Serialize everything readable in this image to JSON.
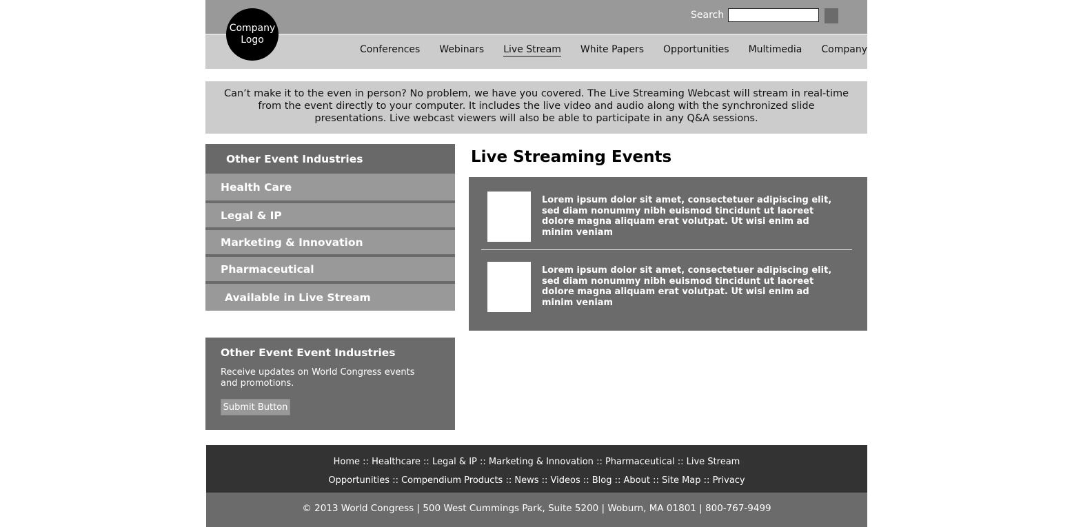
{
  "header": {
    "logo_text": "Company\nLogo",
    "search_label": "Search",
    "search_value": "",
    "nav": [
      {
        "label": "Conferences"
      },
      {
        "label": "Webinars"
      },
      {
        "label": "Live Stream"
      },
      {
        "label": "White Papers"
      },
      {
        "label": "Opportunities"
      },
      {
        "label": "Multimedia"
      },
      {
        "label": "Company"
      }
    ],
    "active_nav": "Live Stream"
  },
  "intro": {
    "text": "Can’t make it to the even in person? No problem, we have you covered. The Live Streaming Webcast will stream in real-time from the event directly to your computer. It includes the live video and audio along with the synchronized slide presentations. Live webcast viewers will also be able to participate in any Q&A sessions."
  },
  "sidebar": {
    "header": "Other Event Industries",
    "items": [
      {
        "label": "Health Care"
      },
      {
        "label": "Legal & IP"
      },
      {
        "label": "Marketing & Innovation"
      },
      {
        "label": "Pharmaceutical"
      },
      {
        "label": "Available in Live Stream"
      }
    ],
    "updates": {
      "title": "Other Event Event Industries",
      "text": "Receive updates on World Congress events and promotions.",
      "button": "Submit Button"
    }
  },
  "main": {
    "title": "Live Streaming Events",
    "events": [
      {
        "text": "Lorem ipsum dolor sit amet, consectetuer adipiscing elit, sed diam nonummy nibh euismod tincidunt ut laoreet dolore magna aliquam erat volutpat. Ut wisi enim ad minim veniam"
      },
      {
        "text": "Lorem ipsum dolor sit amet, consectetuer adipiscing elit, sed diam nonummy nibh euismod tincidunt ut laoreet dolore magna aliquam erat volutpat. Ut wisi enim ad minim veniam"
      }
    ]
  },
  "footer": {
    "row1": [
      "Home",
      "Healthcare",
      "Legal & IP",
      "Marketing & Innovation",
      "Pharmaceutical",
      "Live Stream"
    ],
    "row2": [
      "Opportunities",
      "Compendium Products",
      "News",
      "Videos",
      "Blog",
      "About",
      "Site Map",
      "Privacy"
    ],
    "separator": " :: ",
    "copyright": "© 2013 World Congress | 500 West Cummings Park, Suite 5200 | Woburn, MA 01801 | 800-767-9499"
  },
  "colors": {
    "header_top": "#999999",
    "header_nav": "#cccccc",
    "panel_dark": "#6b6b6b",
    "footer_dark": "#333333"
  }
}
